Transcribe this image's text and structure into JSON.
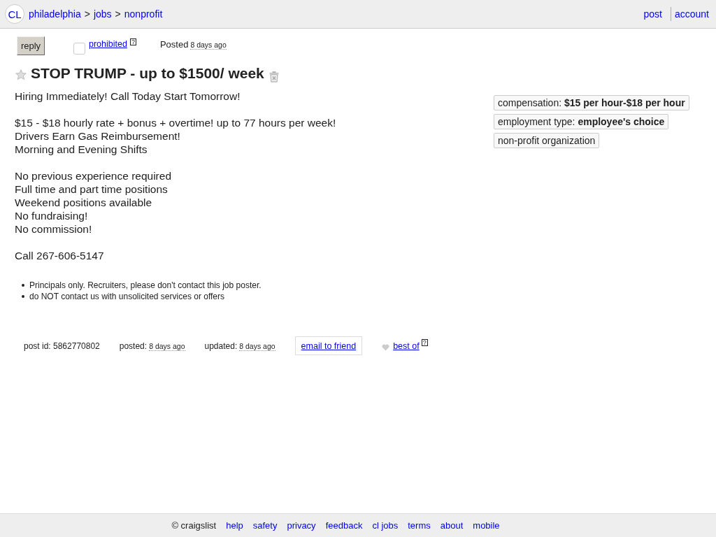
{
  "header": {
    "logo": "CL",
    "breadcrumbs": [
      {
        "label": "philadelphia",
        "separator": ">"
      },
      {
        "label": "jobs",
        "separator": ">"
      },
      {
        "label": "nonprofit"
      }
    ],
    "user_links": [
      "post",
      "account"
    ]
  },
  "toolbar": {
    "reply_button": "reply",
    "flag": {
      "checked": false,
      "label": "prohibited",
      "help": "?"
    },
    "posted": {
      "label": "Posted",
      "time": "8 days ago"
    }
  },
  "title": {
    "text": "STOP TRUMP - up to $1500/ week",
    "starred": false
  },
  "body": [
    [
      "Hiring Immediately! Call Today Start Tomorrow!"
    ],
    [
      "$15 - $18 hourly rate + bonus + overtime! up to 77 hours per week!",
      "Drivers Earn Gas Reimbursement!",
      "Morning and Evening Shifts"
    ],
    [
      "No previous experience required",
      "Full time and part time positions",
      "Weekend positions available",
      "No fundraising!",
      "No commission!"
    ],
    [
      "Call 267-606-5147"
    ]
  ],
  "attributes": [
    "compensation: **$15 per hour-$18 per hour**",
    "employment type: **employee's choice**",
    "non-profit organization"
  ],
  "notices": [
    "Principals only. Recruiters, please don't contact this job poster.",
    "do NOT contact us with unsolicited services or offers"
  ],
  "posting_info": {
    "post_id": "post id: 5862770802",
    "posted": {
      "label": "posted:",
      "time": "8 days ago"
    },
    "updated": {
      "label": "updated:",
      "time": "8 days ago"
    },
    "email_button": "email to friend",
    "best_of": {
      "label": "best of",
      "help": "?"
    }
  },
  "footer": {
    "copyright": "© craigslist",
    "links": [
      "help",
      "safety",
      "privacy",
      "feedback",
      "cl jobs",
      "terms",
      "about",
      "mobile"
    ]
  }
}
